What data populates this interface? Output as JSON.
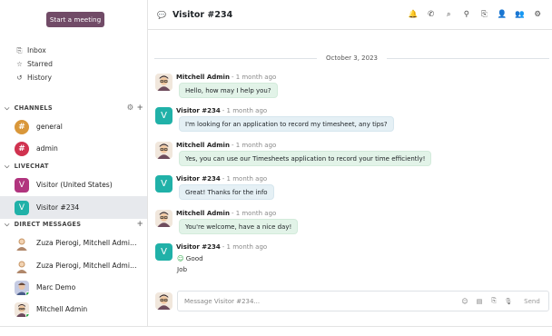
{
  "sidebar": {
    "start_meeting": "Start a meeting",
    "mailboxes": [
      {
        "label": "Inbox",
        "icon": "inbox-icon",
        "glyph": "⎘"
      },
      {
        "label": "Starred",
        "icon": "star-icon",
        "glyph": "☆"
      },
      {
        "label": "History",
        "icon": "history-icon",
        "glyph": "↺"
      }
    ],
    "sections": {
      "channels": "CHANNELS",
      "livechat": "LIVECHAT",
      "direct": "DIRECT MESSAGES"
    },
    "channels": [
      {
        "label": "general",
        "color": "#d9973a"
      },
      {
        "label": "admin",
        "color": "#d0324f"
      }
    ],
    "livechats": [
      {
        "label": "Visitor (United States)",
        "initial": "V",
        "color": "#b1347e"
      },
      {
        "label": "Visitor #234",
        "initial": "V",
        "color": "#20b1a8"
      }
    ],
    "direct_messages": [
      {
        "label": "Zuza Pierogi, Mitchell Admin, a..."
      },
      {
        "label": "Zuza Pierogi, Mitchell Admin, a..."
      },
      {
        "label": "Marc Demo"
      },
      {
        "label": "Mitchell Admin"
      }
    ]
  },
  "header": {
    "title": "Visitor #234",
    "actions": [
      {
        "name": "bell-icon",
        "glyph": "🔔"
      },
      {
        "name": "phone-icon",
        "glyph": "✆"
      },
      {
        "name": "search-icon",
        "glyph": "⌕"
      },
      {
        "name": "pin-icon",
        "glyph": "⚲"
      },
      {
        "name": "paperclip-icon",
        "glyph": "⎘"
      },
      {
        "name": "add-user-icon",
        "glyph": "👤"
      },
      {
        "name": "members-icon",
        "glyph": "👥"
      },
      {
        "name": "gear-icon",
        "glyph": "⚙"
      }
    ]
  },
  "thread": {
    "date": "October 3, 2023",
    "messages": [
      {
        "author": "Mitchell Admin",
        "when": "- 1 month ago",
        "text": "Hello, how may I help you?"
      },
      {
        "author": "Visitor #234",
        "when": "- 1 month ago",
        "text": "I'm looking for an application to record my timesheet, any tips?"
      },
      {
        "author": "Mitchell Admin",
        "when": "- 1 month ago",
        "text": "Yes, you can use our Timesheets application to record your time efficiently!"
      },
      {
        "author": "Visitor #234",
        "when": "- 1 month ago",
        "text": "Great! Thanks for the info"
      },
      {
        "author": "Mitchell Admin",
        "when": "- 1 month ago",
        "text": "You're welcome, have a nice day!"
      },
      {
        "author": "Visitor #234",
        "when": "- 1 month ago",
        "rating_icon": "smile-icon",
        "rating_label": "Good",
        "feedback": "Job"
      }
    ]
  },
  "composer": {
    "placeholder": "Message Visitor #234...",
    "send": "Send"
  }
}
